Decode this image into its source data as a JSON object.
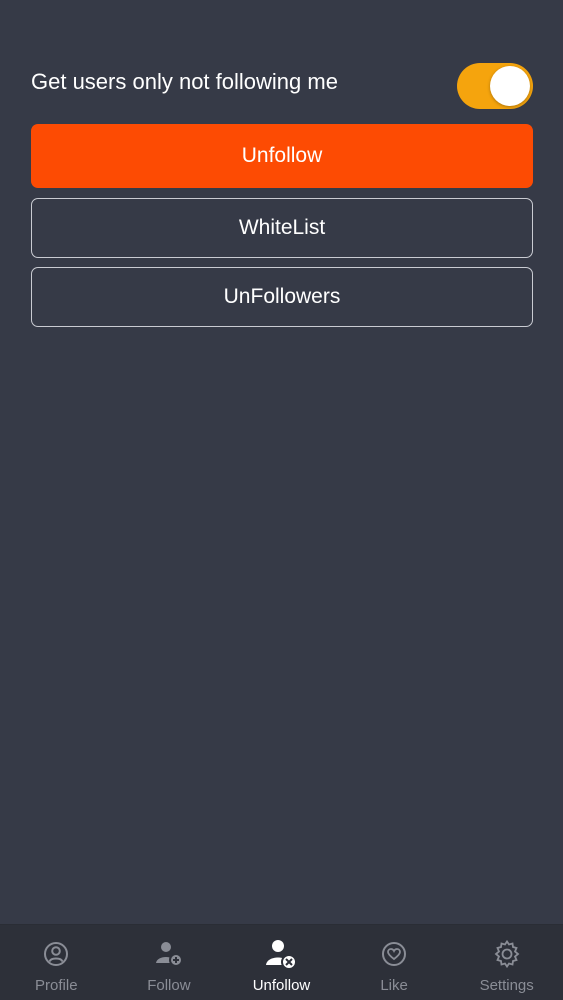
{
  "settings": {
    "toggle_label": "Get users only not following me",
    "toggle_on": true
  },
  "actions": {
    "unfollow_label": "Unfollow",
    "whitelist_label": "WhiteList",
    "unfollowers_label": "UnFollowers"
  },
  "tabs": [
    {
      "label": "Profile",
      "icon": "profile-icon",
      "active": false
    },
    {
      "label": "Follow",
      "icon": "follow-user-icon",
      "active": false
    },
    {
      "label": "Unfollow",
      "icon": "unfollow-user-icon",
      "active": true
    },
    {
      "label": "Like",
      "icon": "heart-icon",
      "active": false
    },
    {
      "label": "Settings",
      "icon": "gear-icon",
      "active": false
    }
  ],
  "colors": {
    "background": "#363a47",
    "tabbar": "#2d3039",
    "accent_primary": "#fd4b03",
    "toggle_on": "#f5a40d",
    "inactive_tab": "#8a8d96",
    "active_tab": "#ffffff"
  }
}
